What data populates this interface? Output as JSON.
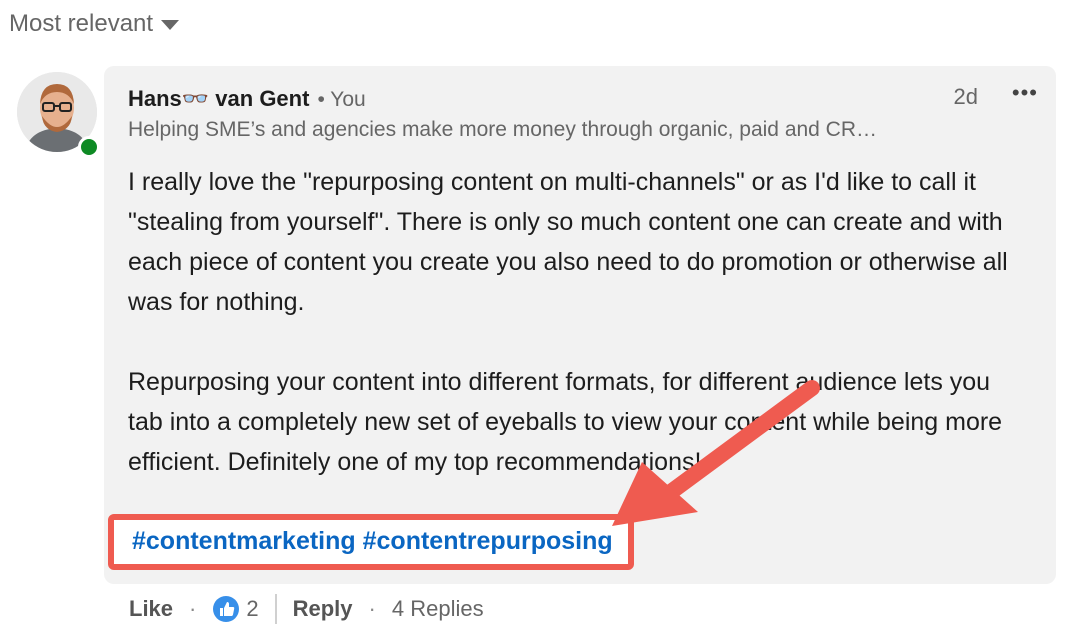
{
  "sort": {
    "label": "Most relevant"
  },
  "comment": {
    "author": "Hans👓 van Gent",
    "relation": "• You",
    "headline": "Helping SME’s and agencies make more money through organic, paid and CR…",
    "time": "2d",
    "more": "•••",
    "paragraphs": [
      "I really love the \"repurposing content on multi-channels\" or as I'd like to call it \"stealing from yourself\". There is only so much content one can create and with each piece of content you create you also need to do promotion or otherwise all was for nothing.",
      "Repurposing your content into different formats, for different audience lets you tab into a completely new set of eyeballs to view your content while being more efficient. Definitely one of my top recommendations!"
    ],
    "hashtags": [
      "#contentmarketing",
      "#contentrepurposing"
    ]
  },
  "actions": {
    "like": "Like",
    "like_count": "2",
    "reply": "Reply",
    "replies": "4 Replies"
  },
  "colors": {
    "link": "#0a66c2",
    "highlight": "#ef5b50",
    "presence": "#0e8a24"
  }
}
